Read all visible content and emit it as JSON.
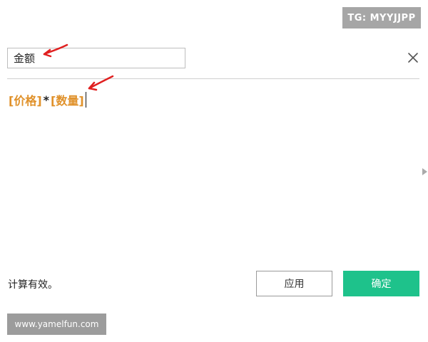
{
  "watermark_top": "TG: MYYJJPP",
  "field_name": {
    "value": "金额",
    "placeholder": ""
  },
  "formula": {
    "field_1": "[价格]",
    "operator": "*",
    "field_2": "[数量]"
  },
  "status_text": "计算有效。",
  "buttons": {
    "apply": "应用",
    "ok": "确定"
  },
  "watermark_bottom": "www.yamelfun.com",
  "colors": {
    "accent": "#1ec28b",
    "field_ref": "#e0912a",
    "annotation": "#e02020"
  },
  "icons": {
    "close": "close-icon",
    "expand": "right-arrow-icon"
  }
}
